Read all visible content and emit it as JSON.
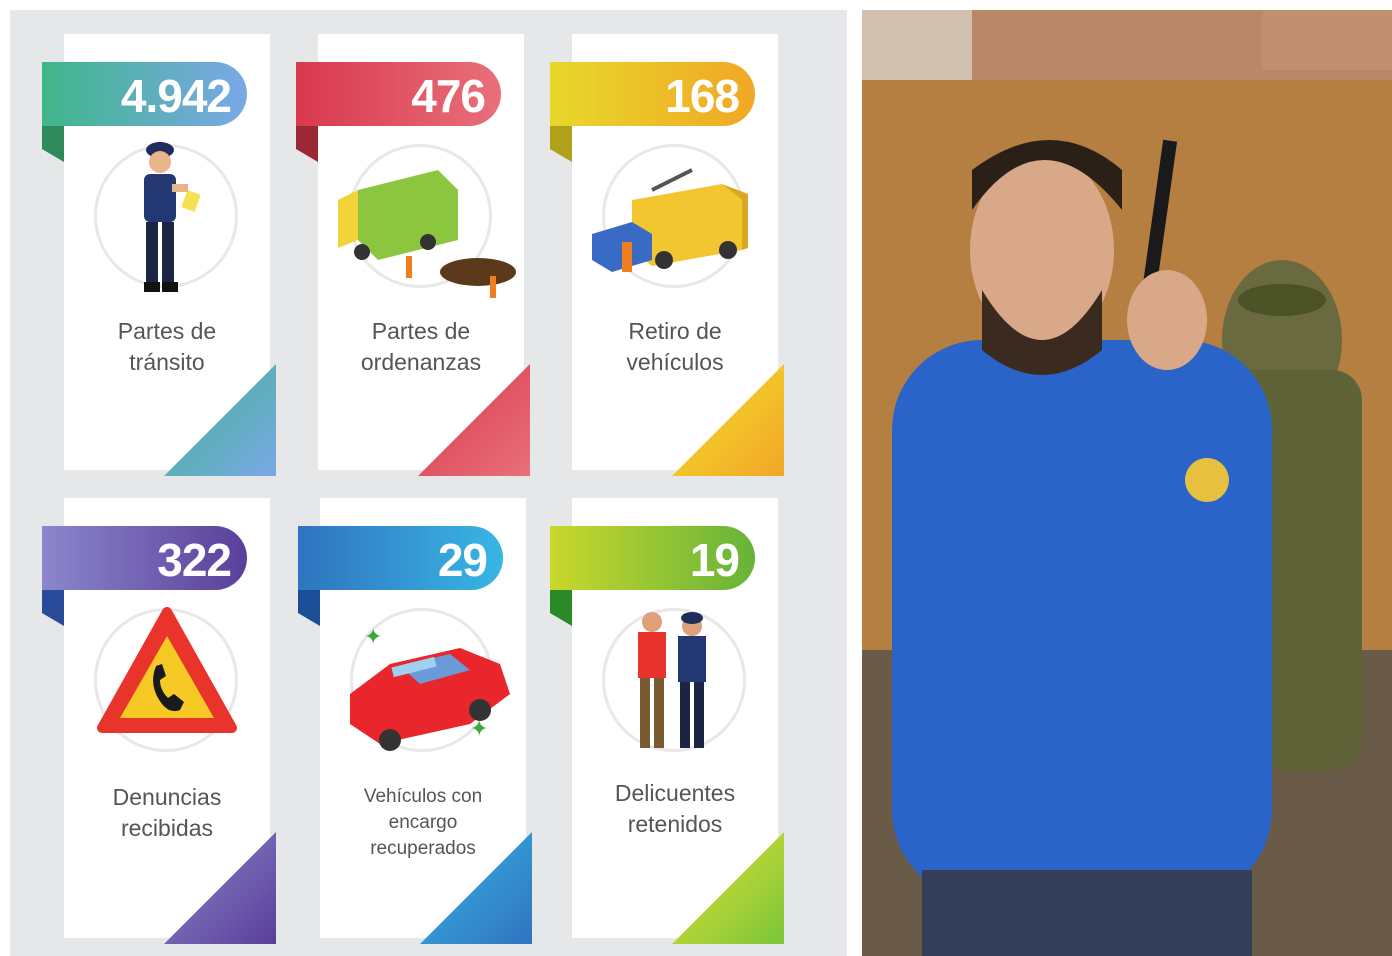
{
  "stats": [
    {
      "value": "4.942",
      "label_line1": "Partes de",
      "label_line2": "tránsito",
      "label_line3": "",
      "icon": "traffic-officer-icon",
      "color_from": "#3fb68a",
      "color_to": "#7ab3e6"
    },
    {
      "value": "476",
      "label_line1": "Partes de",
      "label_line2": "ordenanzas",
      "label_line3": "",
      "icon": "garbage-truck-icon",
      "color_from": "#d9384e",
      "color_to": "#e8707a"
    },
    {
      "value": "168",
      "label_line1": "Retiro de",
      "label_line2": "vehículos",
      "label_line3": "",
      "icon": "tow-truck-icon",
      "color_from": "#e8d82a",
      "color_to": "#f1a726"
    },
    {
      "value": "322",
      "label_line1": "Denuncias",
      "label_line2": "recibidas",
      "label_line3": "",
      "icon": "phone-warning-icon",
      "color_from": "#8b86cc",
      "color_to": "#5a3f9a"
    },
    {
      "value": "29",
      "label_line1": "Vehículos con",
      "label_line2": "encargo",
      "label_line3": "recuperados",
      "icon": "recovered-car-icon",
      "color_from": "#2f74c0",
      "color_to": "#38b6e4"
    },
    {
      "value": "19",
      "label_line1": "Delicuentes",
      "label_line2": "retenidos",
      "label_line3": "",
      "icon": "arrest-icon",
      "color_from": "#c9d82c",
      "color_to": "#3a9c3a"
    }
  ],
  "photo": {
    "subject": "man-with-radio-photo"
  }
}
